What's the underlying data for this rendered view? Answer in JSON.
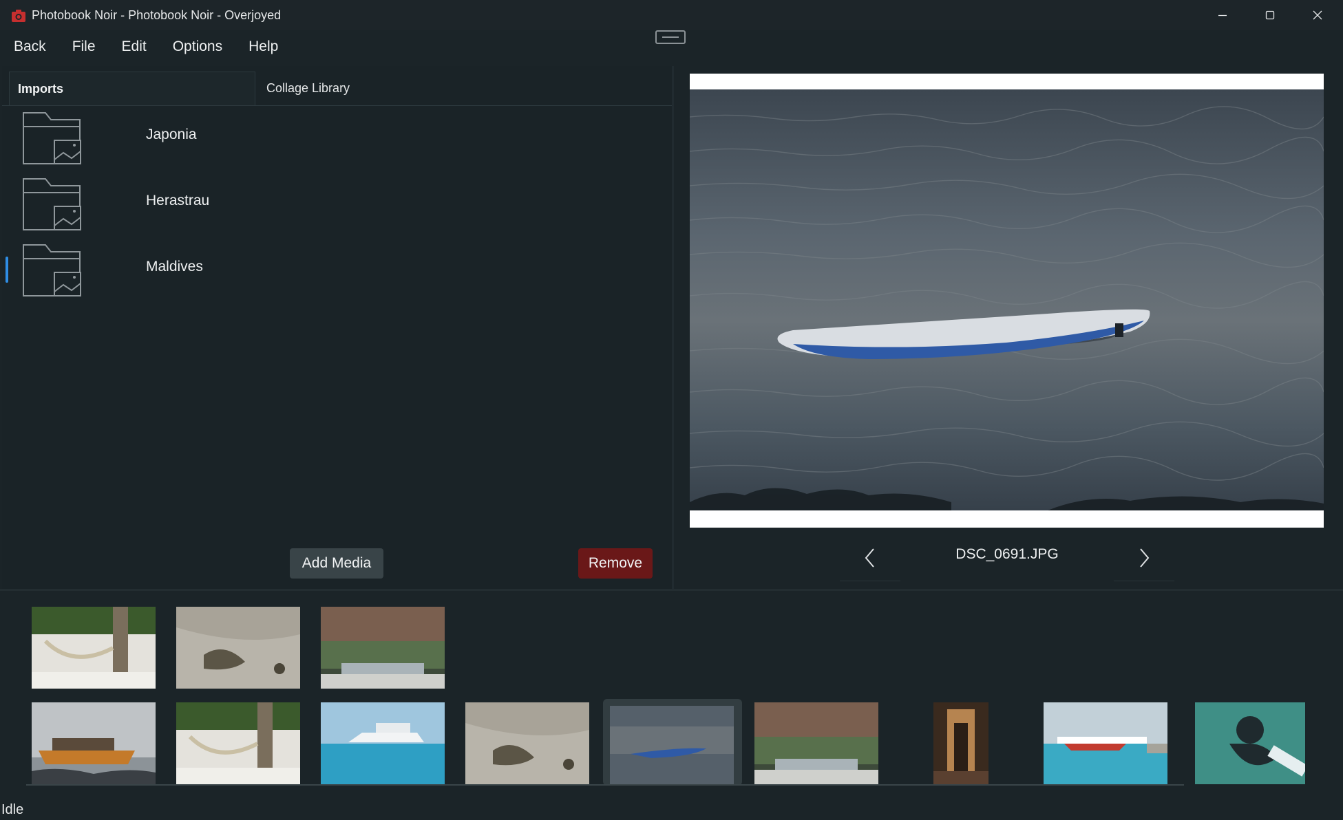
{
  "window": {
    "title": "Photobook Noir - Photobook Noir - Overjoyed",
    "app_icon": "camera-icon",
    "controls": [
      "minimize-icon",
      "maximize-icon",
      "close-icon"
    ]
  },
  "menu": {
    "items": [
      "Back",
      "File",
      "Edit",
      "Options",
      "Help"
    ]
  },
  "tabs": [
    {
      "label": "Imports",
      "active": true
    },
    {
      "label": "Collage Library",
      "active": false
    }
  ],
  "folders": [
    {
      "name": "Japonia",
      "icon": "folder-image-icon"
    },
    {
      "name": "Herastrau",
      "icon": "folder-image-icon"
    },
    {
      "name": "Maldives",
      "icon": "folder-image-icon",
      "selected": true
    }
  ],
  "actions": {
    "add_media": "Add Media",
    "remove": "Remove"
  },
  "preview": {
    "filename": "DSC_0691.JPG",
    "prev_icon": "chevron-left-icon",
    "next_icon": "chevron-right-icon"
  },
  "thumbnails": {
    "row1": [
      "hammock",
      "lizard",
      "hut"
    ],
    "row2": [
      "boat",
      "hammock",
      "yacht",
      "lizard",
      "paddleboard",
      "hut",
      "corridor",
      "seaplane",
      "diver"
    ],
    "selected_index": 4
  },
  "status": {
    "text": "Idle"
  },
  "colors": {
    "background": "#1b2428",
    "accent": "#2f8de4",
    "danger": "#6a1818",
    "button": "#394448"
  }
}
